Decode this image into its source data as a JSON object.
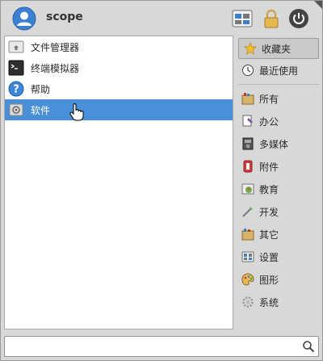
{
  "header": {
    "username": "scope"
  },
  "apps": [
    {
      "label": "文件管理器",
      "icon": "file-manager-icon",
      "selected": false
    },
    {
      "label": "终端模拟器",
      "icon": "terminal-icon",
      "selected": false
    },
    {
      "label": "帮助",
      "icon": "help-icon",
      "selected": false
    },
    {
      "label": "软件",
      "icon": "software-icon",
      "selected": true
    }
  ],
  "categories": [
    {
      "label": "收藏夹",
      "icon": "star-icon",
      "active": true
    },
    {
      "label": "最近使用",
      "icon": "clock-icon"
    },
    {
      "label": "所有",
      "icon": "all-apps-icon"
    },
    {
      "label": "办公",
      "icon": "office-icon"
    },
    {
      "label": "多媒体",
      "icon": "multimedia-icon"
    },
    {
      "label": "附件",
      "icon": "accessories-icon"
    },
    {
      "label": "教育",
      "icon": "education-icon"
    },
    {
      "label": "开发",
      "icon": "development-icon"
    },
    {
      "label": "其它",
      "icon": "other-icon"
    },
    {
      "label": "设置",
      "icon": "settings-icon"
    },
    {
      "label": "图形",
      "icon": "graphics-icon"
    },
    {
      "label": "系统",
      "icon": "system-icon"
    }
  ],
  "search": {
    "value": "",
    "placeholder": ""
  },
  "colors": {
    "selection": "#4a90d9",
    "background": "#d8d8d8"
  }
}
